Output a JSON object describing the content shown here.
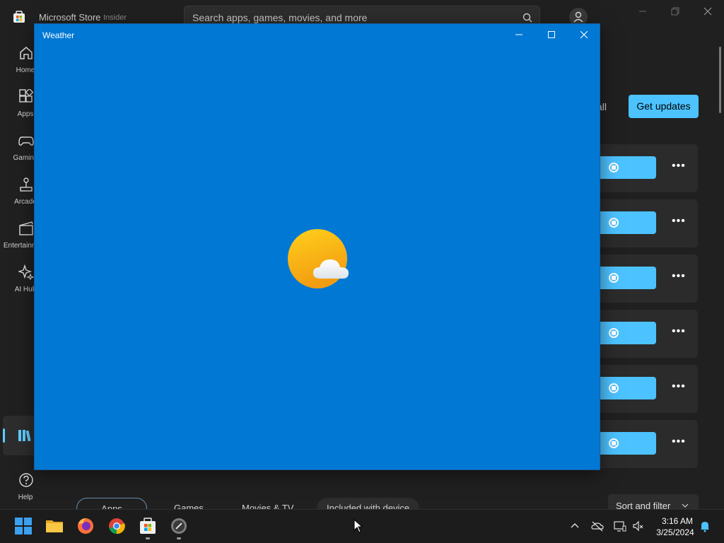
{
  "store": {
    "title": "Microsoft Store",
    "channel": "Insider",
    "search_placeholder": "Search apps, games, movies, and more",
    "nav": [
      {
        "label": "Home",
        "icon": "home-icon"
      },
      {
        "label": "Apps",
        "icon": "apps-icon"
      },
      {
        "label": "Gaming",
        "icon": "gaming-icon"
      },
      {
        "label": "Arcade",
        "icon": "arcade-icon"
      },
      {
        "label": "Entertainment",
        "icon": "entertainment-icon"
      },
      {
        "label": "AI Hub",
        "icon": "ai-hub-icon"
      }
    ],
    "help_label": "Help",
    "update_all_label": "all",
    "get_updates_label": "Get updates",
    "more_label": "•••",
    "filter_tabs": [
      "Apps",
      "Games",
      "Movies & TV",
      "Included with device"
    ],
    "sort_filter_label": "Sort and filter"
  },
  "weather_window": {
    "title": "Weather"
  },
  "taskbar": {
    "apps": [
      "start",
      "file-explorer",
      "firefox",
      "chrome",
      "microsoft-store",
      "settings"
    ],
    "time": "3:16 AM",
    "date": "3/25/2024"
  },
  "colors": {
    "weather_bg": "#0078d4",
    "accent": "#4cc2ff",
    "store_bg": "#202020"
  }
}
